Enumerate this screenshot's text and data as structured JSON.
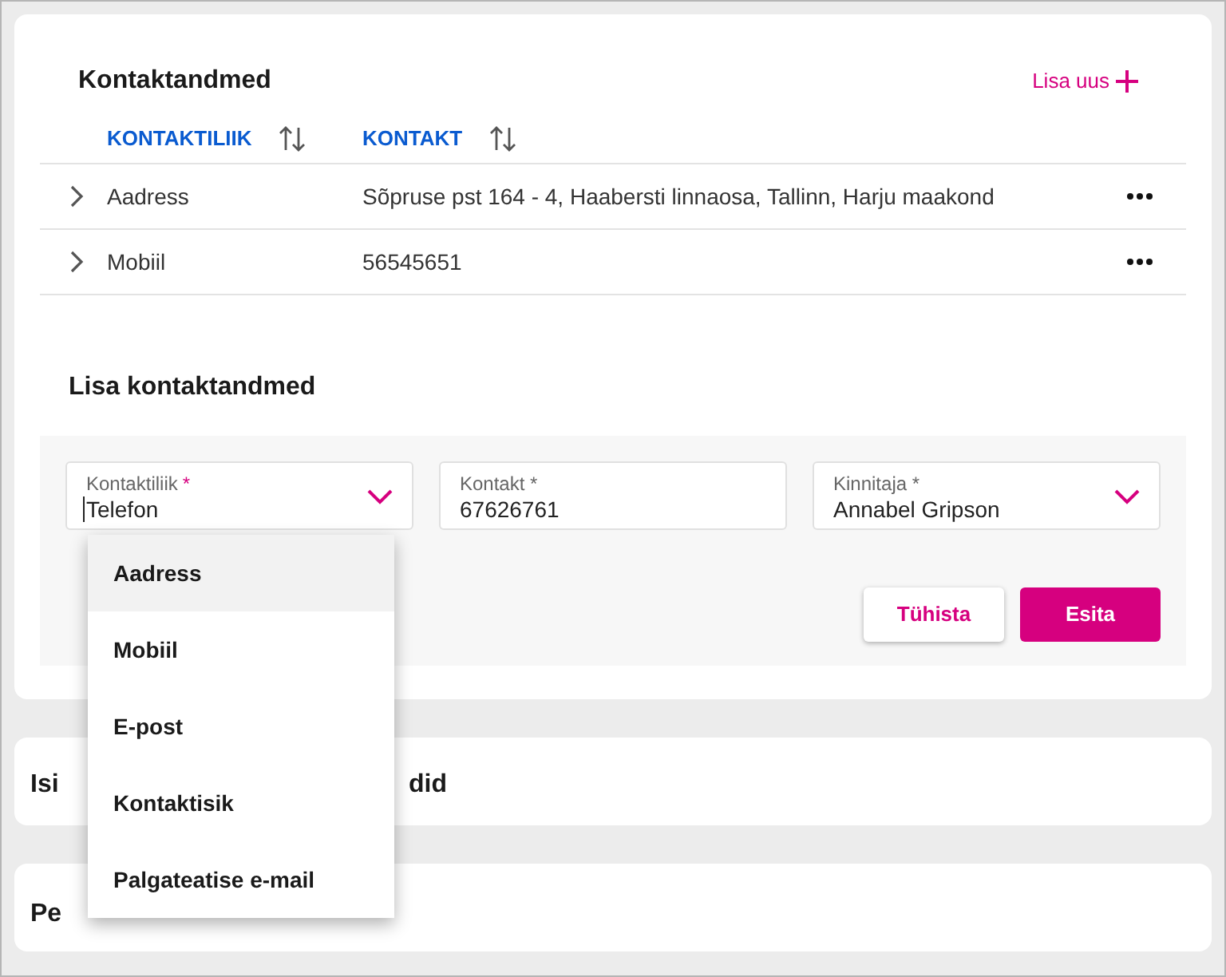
{
  "contacts": {
    "title": "Kontaktandmed",
    "add_link": "Lisa uus",
    "table": {
      "columns": [
        {
          "label": "KONTAKTILIIK"
        },
        {
          "label": "KONTAKT"
        }
      ],
      "rows": [
        {
          "expanded": false,
          "type": "Aadress",
          "value": "Sõpruse pst 164 - 4, Haabersti linnaosa, Tallinn, Harju maakond"
        },
        {
          "expanded": false,
          "type": "Mobiil",
          "value": "56545651"
        }
      ]
    }
  },
  "add_form": {
    "title": "Lisa kontaktandmed",
    "fields": [
      {
        "kind": "select",
        "label": "Kontaktiliik",
        "required_mark": "*",
        "value": "Telefon",
        "focused": true
      },
      {
        "kind": "text",
        "label": "Kontakt *",
        "value": "67626761",
        "focused": false
      },
      {
        "kind": "select",
        "label": "Kinnitaja *",
        "value": "Annabel Gripson",
        "focused": false
      }
    ],
    "buttons": [
      {
        "kind": "secondary",
        "label": "Tühista"
      },
      {
        "kind": "primary",
        "label": "Esita"
      }
    ],
    "dropdown": [
      {
        "label": "Aadress",
        "selected": true
      },
      {
        "label": "Mobiil",
        "selected": false
      },
      {
        "label": "E-post",
        "selected": false
      },
      {
        "label": "Kontaktisik",
        "selected": false
      },
      {
        "label": "Palgateatise e-mail",
        "selected": false
      }
    ]
  },
  "sections": [
    {
      "title_parts": [
        "Isi",
        "did"
      ]
    },
    {
      "title_parts": [
        "Pe"
      ]
    }
  ]
}
